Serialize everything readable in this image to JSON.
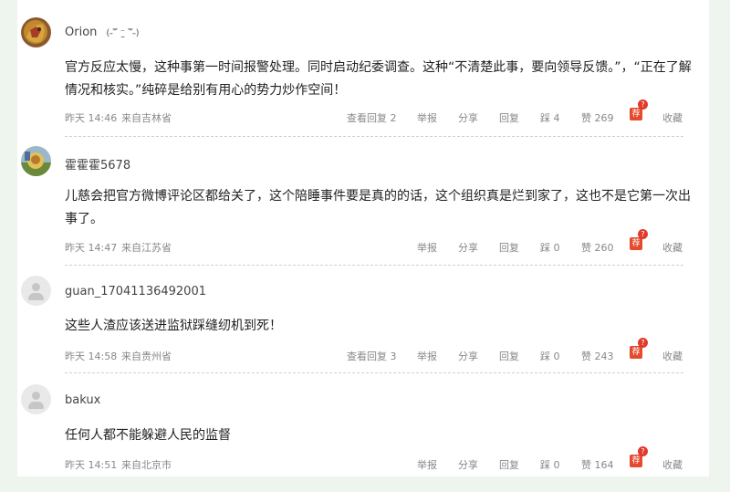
{
  "actions": {
    "view_replies": "查看回复",
    "report": "举报",
    "share": "分享",
    "reply": "回复",
    "dislike": "踩",
    "like": "赞",
    "recommend": "荐",
    "recommend_badge": "?",
    "favorite": "收藏"
  },
  "comments": [
    {
      "username": "Orion",
      "emoticon": "(˶‾᷄ ⁻̫ ‾᷅˵)",
      "text": "官方反应太慢，这种事第一时间报警处理。同时启动纪委调查。这种“不清楚此事，要向领导反馈。”，“正在了解情况和核实。”纯碎是给别有用心的势力炒作空间！",
      "time": "昨天 14:46",
      "location": "来自吉林省",
      "replies": "2",
      "dislikes": "4",
      "likes": "269"
    },
    {
      "username": "霍霍霍5678",
      "text": "儿慈会把官方微博评论区都给关了，这个陪睡事件要是真的的话，这个组织真是烂到家了，这也不是它第一次出事了。",
      "time": "昨天 14:47",
      "location": "来自江苏省",
      "dislikes": "0",
      "likes": "260"
    },
    {
      "username": "guan_17041136492001",
      "text": "这些人渣应该送进监狱踩缝纫机到死！",
      "time": "昨天 14:58",
      "location": "来自贵州省",
      "replies": "3",
      "dislikes": "0",
      "likes": "243"
    },
    {
      "username": "bakux",
      "text": "任何人都不能躲避人民的监督",
      "time": "昨天 14:51",
      "location": "来自北京市",
      "dislikes": "0",
      "likes": "164"
    }
  ]
}
